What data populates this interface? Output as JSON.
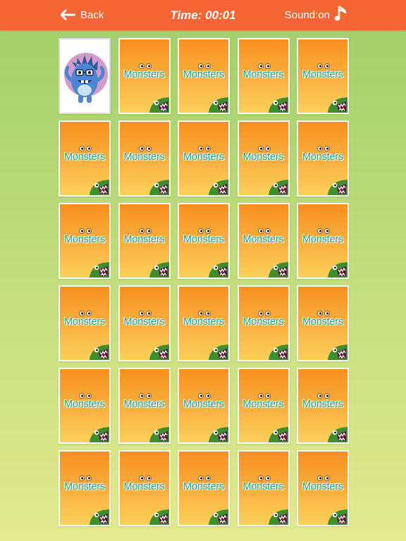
{
  "header": {
    "back_label": "Back",
    "timer": "Time: 00:01",
    "sound_label": "Sound:on"
  },
  "icons": {
    "back": "arrow-left-icon",
    "sound": "music-note-icon",
    "card_face": "blue-monster-icon"
  },
  "colors": {
    "header_bg": "#f56634",
    "card_top": "#f7901f",
    "card_bottom": "#fbd05b",
    "card_text": "#19a48e"
  },
  "board": {
    "columns": 5,
    "rows": 6,
    "card_back_text": "Monsters",
    "revealed_cards": [
      0
    ]
  }
}
